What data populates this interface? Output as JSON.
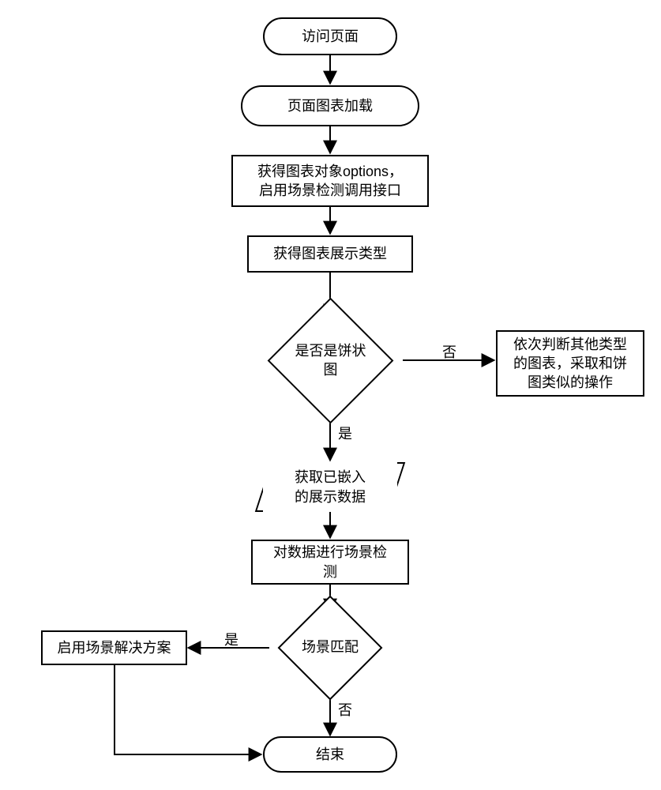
{
  "flowchart": {
    "nodes": {
      "start": {
        "text": "访问页面",
        "type": "terminator"
      },
      "load": {
        "text": "页面图表加载",
        "type": "terminator"
      },
      "get_options": {
        "text": "获得图表对象options，\n启用场景检测调用接口",
        "type": "process"
      },
      "get_type": {
        "text": "获得图表展示类型",
        "type": "process"
      },
      "is_pie": {
        "text": "是否是饼状图",
        "type": "decision"
      },
      "other_type": {
        "text": "依次判断其他类型\n的图表，采取和饼\n图类似的操作",
        "type": "process"
      },
      "get_embedded": {
        "text": "获取已嵌入\n的展示数据",
        "type": "io"
      },
      "scene_detect": {
        "text": "对数据进行场景检\n测",
        "type": "process"
      },
      "scene_match": {
        "text": "场景匹配",
        "type": "decision"
      },
      "enable_solution": {
        "text": "启用场景解决方案",
        "type": "process"
      },
      "end": {
        "text": "结束",
        "type": "terminator"
      }
    },
    "edges": [
      {
        "from": "start",
        "to": "load",
        "label": null
      },
      {
        "from": "load",
        "to": "get_options",
        "label": null
      },
      {
        "from": "get_options",
        "to": "get_type",
        "label": null
      },
      {
        "from": "get_type",
        "to": "is_pie",
        "label": null
      },
      {
        "from": "is_pie",
        "to": "other_type",
        "label": "否"
      },
      {
        "from": "is_pie",
        "to": "get_embedded",
        "label": "是"
      },
      {
        "from": "get_embedded",
        "to": "scene_detect",
        "label": null
      },
      {
        "from": "scene_detect",
        "to": "scene_match",
        "label": null
      },
      {
        "from": "scene_match",
        "to": "enable_solution",
        "label": "是"
      },
      {
        "from": "scene_match",
        "to": "end",
        "label": "否"
      },
      {
        "from": "enable_solution",
        "to": "end",
        "label": null
      }
    ],
    "edge_labels": {
      "yes": "是",
      "no": "否"
    }
  }
}
